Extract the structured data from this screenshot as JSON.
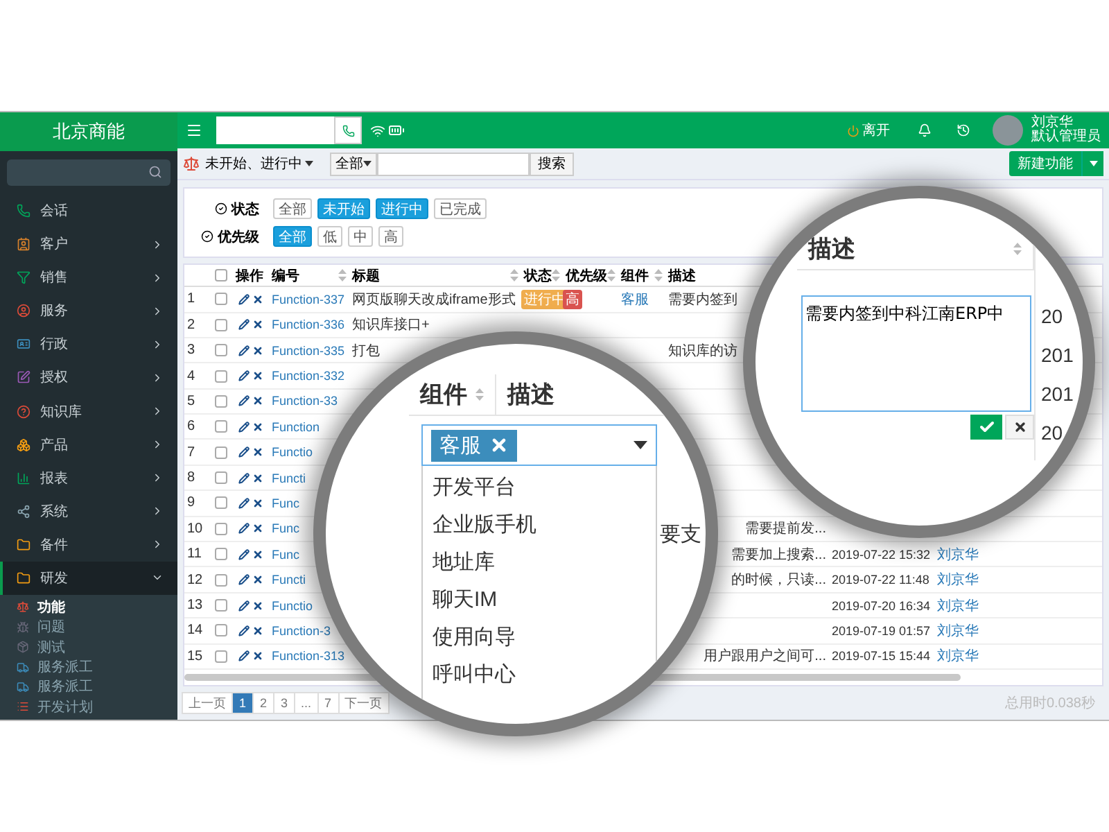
{
  "sidebar": {
    "brand": "北京商能",
    "items": [
      {
        "label": "会话",
        "kind": "link"
      },
      {
        "label": "客户",
        "kind": "group",
        "expanded": false
      },
      {
        "label": "销售",
        "kind": "group",
        "expanded": false
      },
      {
        "label": "服务",
        "kind": "group",
        "expanded": false
      },
      {
        "label": "行政",
        "kind": "group",
        "expanded": false
      },
      {
        "label": "授权",
        "kind": "group",
        "expanded": false
      },
      {
        "label": "知识库",
        "kind": "group",
        "expanded": false
      },
      {
        "label": "产品",
        "kind": "group",
        "expanded": false
      },
      {
        "label": "报表",
        "kind": "group",
        "expanded": false
      },
      {
        "label": "系统",
        "kind": "group",
        "expanded": false
      },
      {
        "label": "备件",
        "kind": "group",
        "expanded": false
      },
      {
        "label": "研发",
        "kind": "group",
        "expanded": true,
        "children": [
          {
            "label": "功能",
            "selected": true
          },
          {
            "label": "问题",
            "selected": false
          },
          {
            "label": "测试",
            "selected": false
          },
          {
            "label": "服务派工",
            "selected": false
          },
          {
            "label": "服务派工",
            "selected": false
          },
          {
            "label": "开发计划",
            "selected": false
          }
        ]
      }
    ]
  },
  "topbar": {
    "status": "离开",
    "user": {
      "name": "刘京华",
      "role": "默认管理员"
    }
  },
  "toolbar": {
    "view": "未开始、进行中",
    "scope": "全部",
    "search_button": "搜索",
    "new_button": "新建功能"
  },
  "filters": [
    {
      "label": "状态",
      "options": [
        {
          "label": "全部",
          "selected": false
        },
        {
          "label": "未开始",
          "selected": true
        },
        {
          "label": "进行中",
          "selected": true
        },
        {
          "label": "已完成",
          "selected": false
        }
      ]
    },
    {
      "label": "优先级",
      "options": [
        {
          "label": "全部",
          "selected": true
        },
        {
          "label": "低",
          "selected": false
        },
        {
          "label": "中",
          "selected": false
        },
        {
          "label": "高",
          "selected": false
        }
      ]
    }
  ],
  "table": {
    "all_checked": false,
    "columns": [
      {
        "label": "操作",
        "sortable": false
      },
      {
        "label": "编号",
        "sortable": true
      },
      {
        "label": "标题",
        "sortable": true
      },
      {
        "label": "状态",
        "sortable": true
      },
      {
        "label": "优先级",
        "sortable": true
      },
      {
        "label": "组件",
        "sortable": true
      },
      {
        "label": "描述",
        "sortable": false
      }
    ],
    "rows": [
      {
        "number": "1",
        "checked": false,
        "code": "Function-337",
        "title": "网页版聊天改成iframe形式",
        "status": {
          "label": "进行中",
          "color": "#f0ad4e"
        },
        "priority": {
          "label": "高",
          "color": "#d9534f"
        },
        "component": "客服",
        "description": "需要内签到"
      },
      {
        "number": "2",
        "checked": false,
        "code": "Function-336",
        "title": "知识库接口+"
      },
      {
        "number": "3",
        "checked": false,
        "code": "Function-335",
        "title": "打包",
        "description": "知识库的访"
      },
      {
        "number": "4",
        "checked": false,
        "code": "Function-332"
      },
      {
        "number": "5",
        "checked": false,
        "code": "Function-33"
      },
      {
        "number": "6",
        "checked": false,
        "code": "Function"
      },
      {
        "number": "7",
        "checked": false,
        "code": "Functio"
      },
      {
        "number": "8",
        "checked": false,
        "code": "Functi"
      },
      {
        "number": "9",
        "checked": false,
        "code": "Func"
      },
      {
        "number": "10",
        "checked": false,
        "code": "Func",
        "description": "需要提前发..."
      },
      {
        "number": "11",
        "checked": false,
        "code": "Func",
        "description": "需要加上搜索...",
        "time": "2019-07-22 15:32",
        "owner": "刘京华"
      },
      {
        "number": "12",
        "checked": false,
        "code": "Functi",
        "description": "的时候，只读...",
        "time": "2019-07-22 11:48",
        "owner": "刘京华"
      },
      {
        "number": "13",
        "checked": false,
        "code": "Functio",
        "time": "2019-07-20 16:34",
        "owner": "刘京华"
      },
      {
        "number": "14",
        "checked": false,
        "code": "Function-3",
        "time": "2019-07-19 01:57",
        "owner": "刘京华"
      },
      {
        "number": "15",
        "checked": false,
        "code": "Function-313",
        "description": "用户跟用户之间可...",
        "time": "2019-07-15 15:44",
        "owner": "刘京华"
      }
    ]
  },
  "pagination": {
    "prev": "上一页",
    "pages": [
      {
        "label": "1",
        "selected": true
      },
      {
        "label": "2",
        "selected": false
      },
      {
        "label": "3",
        "selected": false
      },
      {
        "label": "...",
        "selected": false
      },
      {
        "label": "7",
        "selected": false
      }
    ],
    "next": "下一页"
  },
  "footer": "总用时0.038秒",
  "magnifiers": [
    {
      "kind": "component-select",
      "headers": [
        {
          "label": "组件",
          "sortable": true
        },
        {
          "label": "描述",
          "sortable": false
        }
      ],
      "tag": "客服",
      "options": [
        "开发平台",
        "企业版手机",
        "地址库",
        "聊天IM",
        "使用向导",
        "呼叫中心"
      ],
      "side_text": "要支"
    },
    {
      "kind": "description-editor",
      "headers": [
        {
          "label": "描述",
          "sortable": true
        }
      ],
      "value": "需要内签到中科江南ERP中",
      "side_cells": [
        "20",
        "201",
        "201",
        "20"
      ]
    }
  ]
}
